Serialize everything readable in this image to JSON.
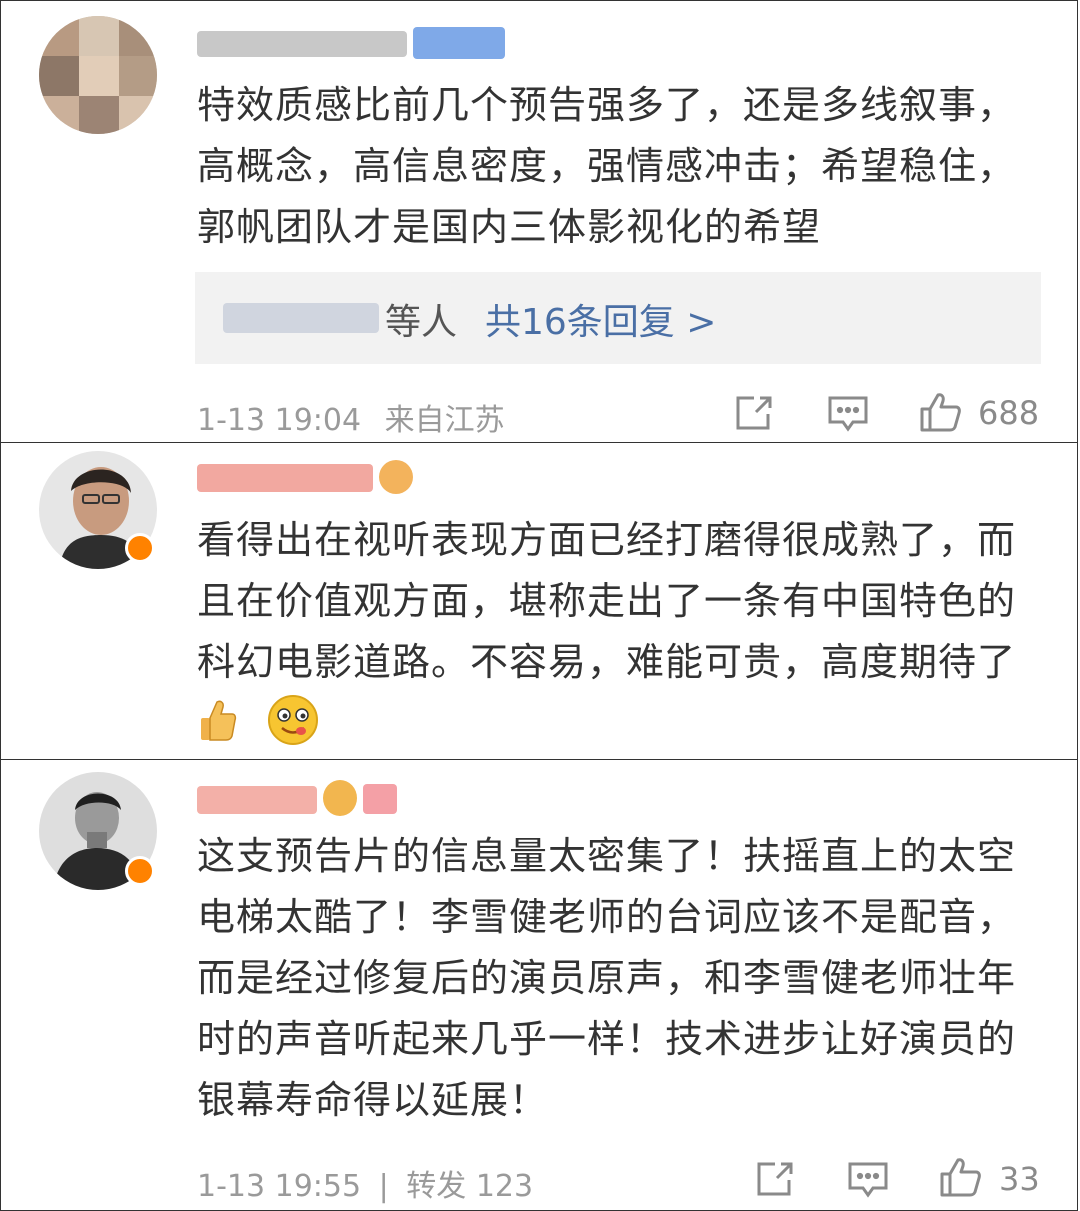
{
  "comments": [
    {
      "text": "特效质感比前几个预告强多了，还是多线叙事，高概念，高信息密度，强情感冲击；希望稳住，郭帆团队才是国内三体影视化的希望",
      "replies": {
        "suffix": "等人",
        "link": "共16条回复 >"
      },
      "footer": {
        "time": "1-13 19:04",
        "source": "来自江苏"
      },
      "actions": {
        "share_icon": "share-icon",
        "comment_icon": "comment-icon",
        "like_icon": "thumbs-up-icon",
        "like_count": "688"
      }
    },
    {
      "text": "看得出在视听表现方面已经打磨得很成熟了，而且在价值观方面，堪称走出了一条有中国特色的科幻电影道路。不容易，难能可贵，高度期待了",
      "emojis": [
        "thumbs-up-emoji",
        "drooling-face-emoji"
      ]
    },
    {
      "text": "这支预告片的信息量太密集了！扶摇直上的太空电梯太酷了！李雪健老师的台词应该不是配音，而是经过修复后的演员原声，和李雪健老师壮年时的声音听起来几乎一样！技术进步让好演员的银幕寿命得以延展！",
      "footer": {
        "time": "1-13 19:55",
        "separator": "|",
        "repost": "转发 123"
      },
      "actions": {
        "share_icon": "share-icon",
        "comment_icon": "comment-icon",
        "like_icon": "thumbs-up-icon",
        "like_count": "33"
      }
    }
  ],
  "colors": {
    "link": "#4a6fa5",
    "meta": "#9a9a9a",
    "verified": "#ff8200"
  }
}
